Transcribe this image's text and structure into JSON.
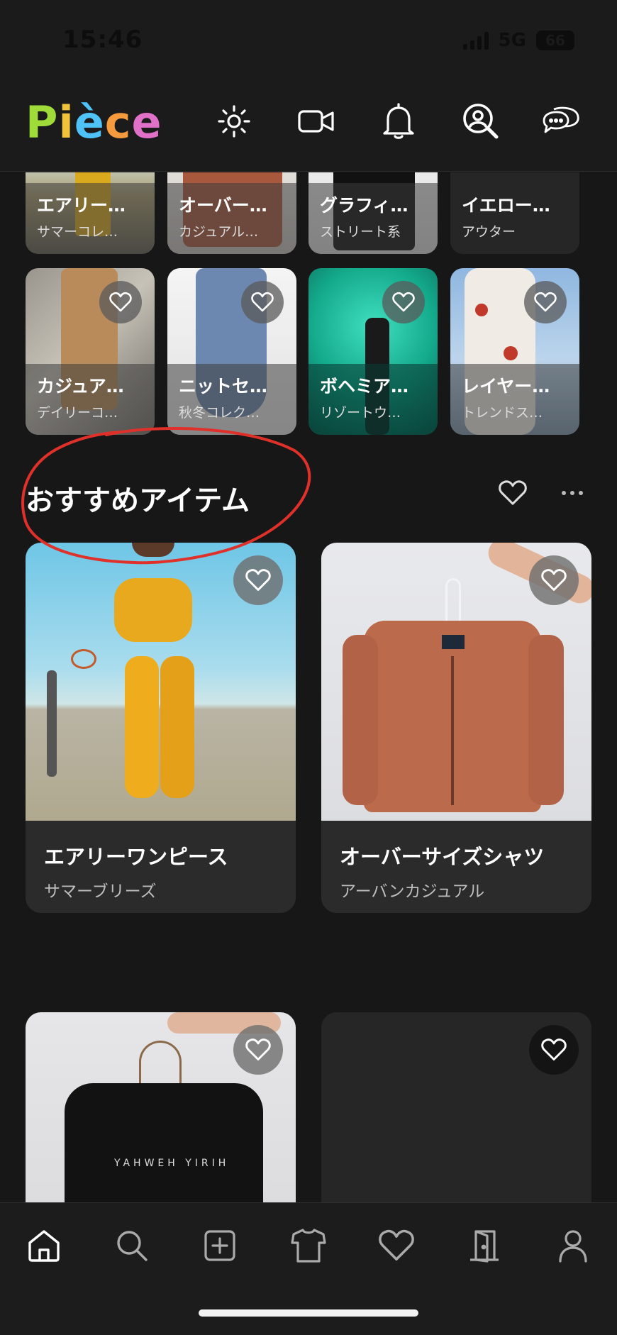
{
  "status_bar": {
    "time": "15:46",
    "network": "5G",
    "battery": "66"
  },
  "header": {
    "logo_letters": [
      "P",
      "i",
      "è",
      "c",
      "e"
    ],
    "logo_colors": [
      "#9fdc3a",
      "#f0c43a",
      "#4fc3f7",
      "#f59a3d",
      "#e070c8"
    ],
    "icons": [
      "sun-icon",
      "video-camera-icon",
      "bell-icon",
      "user-search-icon",
      "chat-bubbles-icon"
    ]
  },
  "mini_cards_row1": [
    {
      "title": "エアリー…",
      "sub": "サマーコレ…"
    },
    {
      "title": "オーバー…",
      "sub": "カジュアル…"
    },
    {
      "title": "グラフィ…",
      "sub": "ストリート系"
    },
    {
      "title": "イエロー…",
      "sub": "アウター"
    }
  ],
  "mini_cards_row2": [
    {
      "title": "カジュア…",
      "sub": "デイリーコ…"
    },
    {
      "title": "ニットセ…",
      "sub": "秋冬コレク…"
    },
    {
      "title": "ボヘミア…",
      "sub": "リゾートウ…"
    },
    {
      "title": "レイヤー…",
      "sub": "トレンドス…"
    }
  ],
  "section": {
    "title": "おすすめアイテム"
  },
  "recommended": [
    {
      "title": "エアリーワンピース",
      "sub": "サマーブリーズ"
    },
    {
      "title": "オーバーサイズシャツ",
      "sub": "アーバンカジュアル"
    },
    {
      "title": "",
      "sub": "",
      "print_text": "YAHWEH YIRIH"
    },
    {
      "title": "",
      "sub": ""
    }
  ],
  "colors": {
    "background": "#171717",
    "card": "#2b2b2b",
    "annotation": "#e0302a"
  },
  "bottom_nav": [
    "home-icon",
    "search-icon",
    "add-post-icon",
    "tshirt-icon",
    "heart-icon",
    "door-icon",
    "profile-icon"
  ]
}
